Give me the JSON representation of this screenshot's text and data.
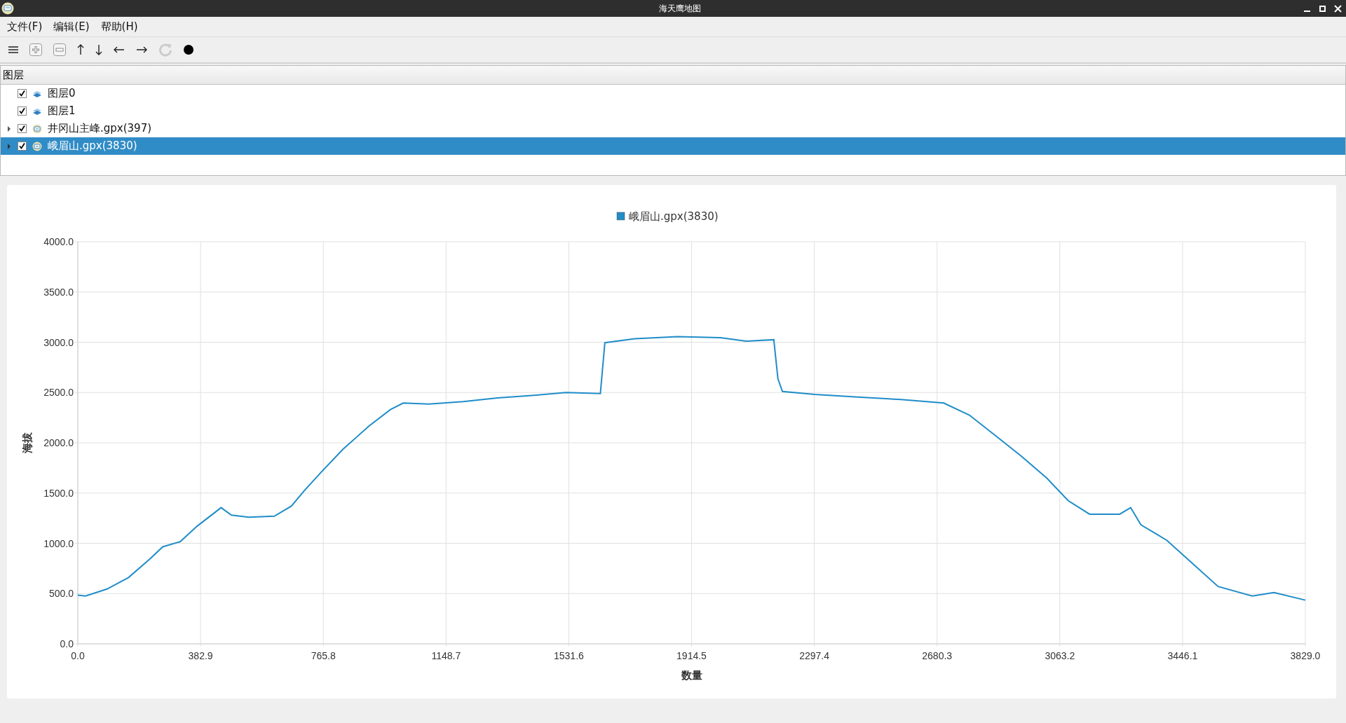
{
  "window": {
    "title": "海天鹰地图"
  },
  "menu": [
    "文件(F)",
    "编辑(E)",
    "帮助(H)"
  ],
  "toolbar": [
    {
      "kind": "menu",
      "disabled": false
    },
    {
      "kind": "plus",
      "disabled": false
    },
    {
      "kind": "minus",
      "disabled": false
    },
    {
      "kind": "up",
      "disabled": false
    },
    {
      "kind": "down",
      "disabled": false
    },
    {
      "kind": "left",
      "disabled": false
    },
    {
      "kind": "right",
      "disabled": false
    },
    {
      "kind": "refresh",
      "disabled": true
    },
    {
      "kind": "dot",
      "disabled": false
    }
  ],
  "layers": {
    "header": "图层",
    "items": [
      {
        "label": "图层0",
        "kind": "layer",
        "checked": true,
        "selected": false
      },
      {
        "label": "图层1",
        "kind": "layer",
        "checked": true,
        "selected": false
      },
      {
        "label": "井冈山主峰.gpx(397)",
        "kind": "track",
        "checked": true,
        "selected": false,
        "expanded": false
      },
      {
        "label": "峨眉山.gpx(3830)",
        "kind": "track",
        "checked": true,
        "selected": true,
        "expanded": false
      }
    ]
  },
  "chart": {
    "chart_data": {
      "type": "line",
      "grid": true,
      "xlabel": "数量",
      "ylabel": "海拔",
      "x": [
        0,
        24,
        91,
        158,
        225,
        265,
        319,
        372,
        447,
        479,
        533,
        613,
        666,
        707,
        760,
        827,
        908,
        975,
        1015,
        1095,
        1202,
        1309,
        1416,
        1523,
        1630,
        1644,
        1737,
        1871,
        2005,
        2085,
        2171,
        2184,
        2198,
        2299,
        2433,
        2567,
        2701,
        2781,
        2861,
        2942,
        3022,
        3089,
        3156,
        3250,
        3284,
        3316,
        3397,
        3477,
        3557,
        3664,
        3731,
        3829
      ],
      "series": [
        {
          "name": "峨眉山.gpx(3830)",
          "color": "#1f8dc8",
          "values": [
            484,
            475,
            545,
            660,
            845,
            965,
            1015,
            1170,
            1355,
            1280,
            1260,
            1270,
            1370,
            1525,
            1710,
            1935,
            2165,
            2330,
            2395,
            2385,
            2410,
            2445,
            2470,
            2500,
            2490,
            2995,
            3035,
            3055,
            3045,
            3010,
            3025,
            2635,
            2510,
            2480,
            2455,
            2430,
            2395,
            2275,
            2075,
            1870,
            1650,
            1425,
            1290,
            1290,
            1355,
            1185,
            1030,
            800,
            570,
            475,
            510,
            435
          ]
        }
      ],
      "xlim": [
        0,
        3829
      ],
      "ylim": [
        0,
        4000
      ],
      "xticks": [
        {
          "value": 0,
          "label": "0.0"
        },
        {
          "value": 382.9,
          "label": "382.9"
        },
        {
          "value": 765.8,
          "label": "765.8"
        },
        {
          "value": 1148.7,
          "label": "1148.7"
        },
        {
          "value": 1531.6,
          "label": "1531.6"
        },
        {
          "value": 1914.5,
          "label": "1914.5"
        },
        {
          "value": 2297.4,
          "label": "2297.4"
        },
        {
          "value": 2680.3,
          "label": "2680.3"
        },
        {
          "value": 3063.2,
          "label": "3063.2"
        },
        {
          "value": 3446.1,
          "label": "3446.1"
        },
        {
          "value": 3829,
          "label": "3829.0"
        }
      ],
      "yticks": [
        {
          "value": 0,
          "label": "0.0"
        },
        {
          "value": 500,
          "label": "500.0"
        },
        {
          "value": 1000,
          "label": "1000.0"
        },
        {
          "value": 1500,
          "label": "1500.0"
        },
        {
          "value": 2000,
          "label": "2000.0"
        },
        {
          "value": 2500,
          "label": "2500.0"
        },
        {
          "value": 3000,
          "label": "3000.0"
        },
        {
          "value": 3500,
          "label": "3500.0"
        },
        {
          "value": 4000,
          "label": "4000.0"
        }
      ]
    }
  }
}
